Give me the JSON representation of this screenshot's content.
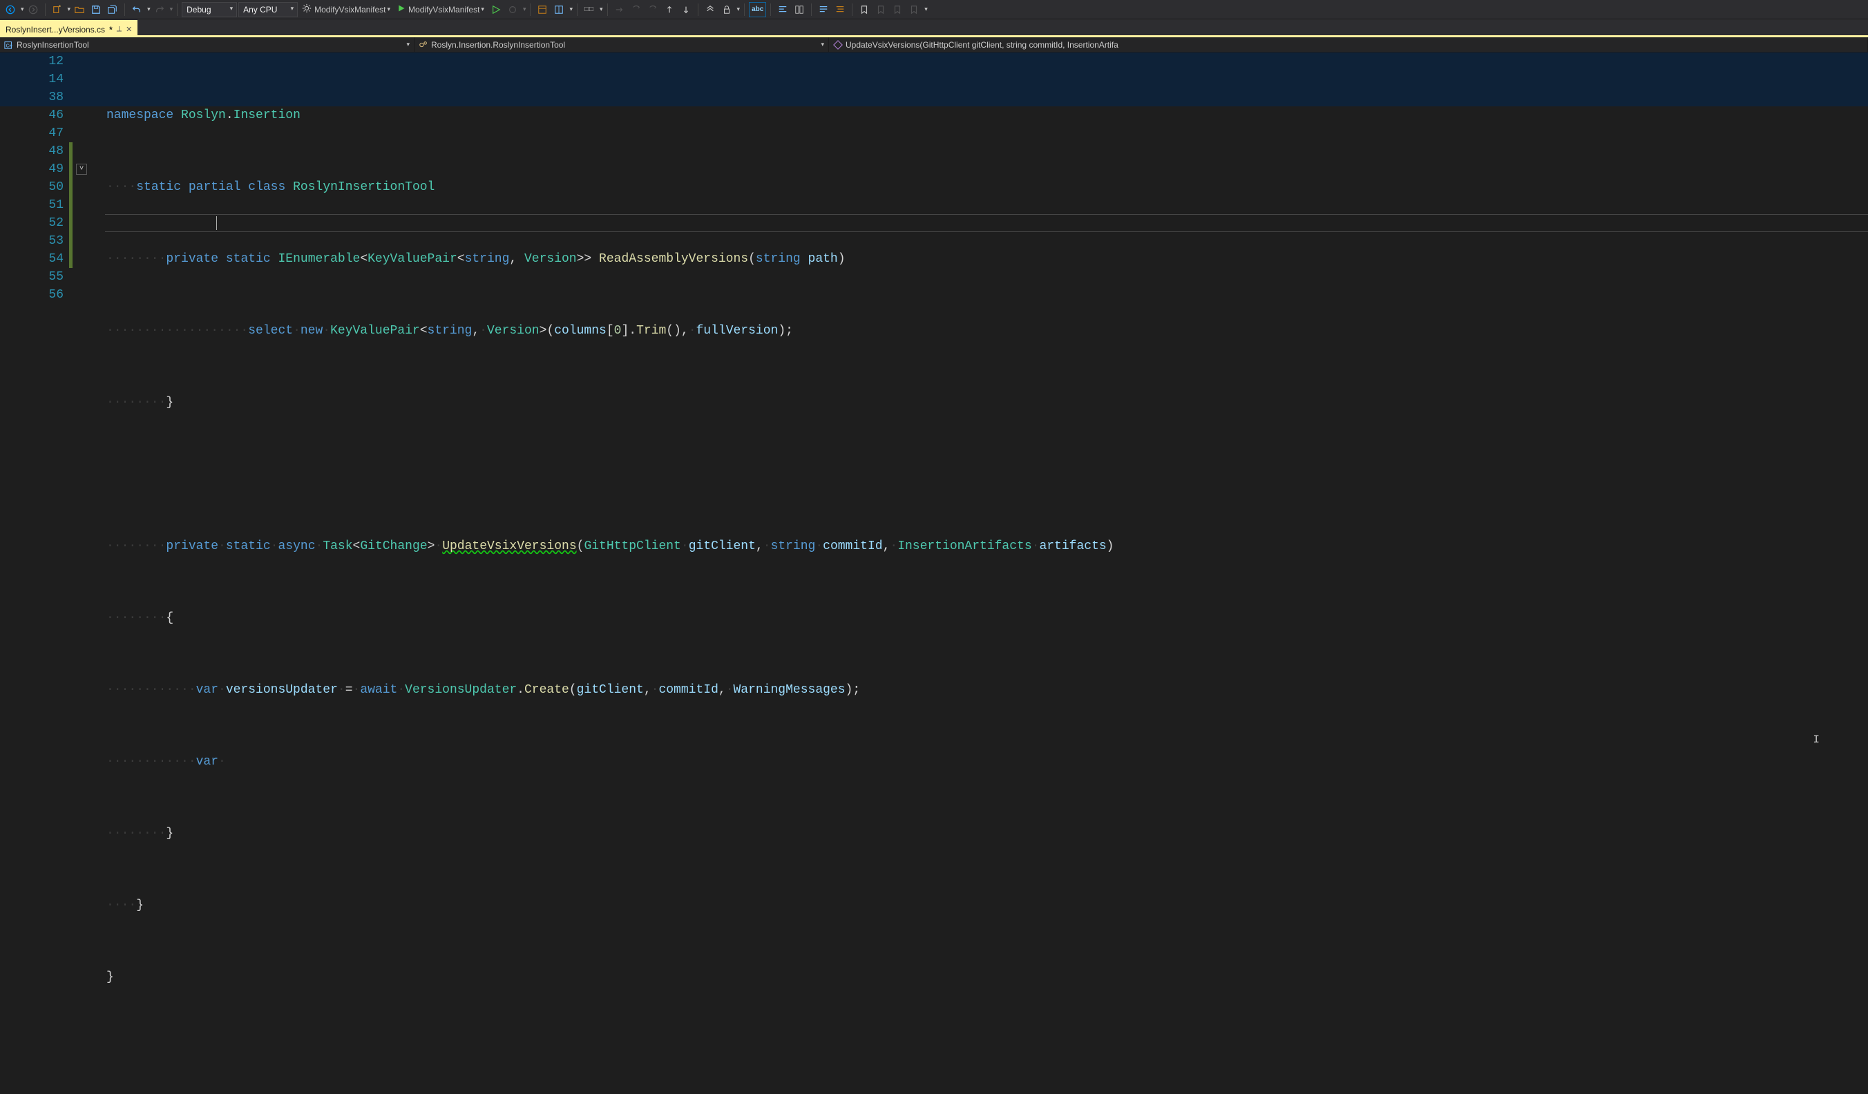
{
  "toolbar": {
    "config_combo": "Debug",
    "platform_combo": "Any CPU",
    "start1": "ModifyVsixManifest",
    "start2": "ModifyVsixManifest"
  },
  "tab": {
    "title": "RoslynInsert...yVersions.cs",
    "dirty": "*",
    "pin_glyph": "⟂",
    "close_glyph": "✕"
  },
  "nav": {
    "project": "RoslynInsertionTool",
    "type": "Roslyn.Insertion.RoslynInsertionTool",
    "member": "UpdateVsixVersions(GitHttpClient gitClient, string commitId, InsertionArtifa"
  },
  "line_numbers": [
    "12",
    "14",
    "38",
    "46",
    "47",
    "48",
    "49",
    "50",
    "51",
    "52",
    "53",
    "54",
    "55",
    "56"
  ],
  "code": {
    "l12": {
      "indent": "",
      "t1": "namespace",
      "t2": " ",
      "t3": "Roslyn",
      "t4": ".",
      "t5": "Insertion"
    },
    "l14": {
      "indent_ws": "····",
      "t1": "static",
      "t2": " ",
      "t3": "partial",
      "t4": " ",
      "t5": "class",
      "t6": " ",
      "t7": "RoslynInsertionTool"
    },
    "l38": {
      "indent_ws": "········",
      "t1": "private",
      "t2": " ",
      "t3": "static",
      "t4": " ",
      "t5": "IEnumerable",
      "t6": "<",
      "t7": "KeyValuePair",
      "t8": "<",
      "t9": "string",
      "t10": ",",
      "t11": " ",
      "t12": "Version",
      "t13": ">>",
      "t14": " ",
      "t15": "ReadAssemblyVersions",
      "t16": "(",
      "t17": "string",
      "t18": " ",
      "t19": "path",
      "t20": ")"
    },
    "l46": {
      "indent_ws": "···············",
      "t0": "····",
      "t1": "select",
      "t2": "·",
      "t3": "new",
      "t4": "·",
      "t5": "KeyValuePair",
      "t6": "<",
      "t7": "string",
      "t8": ",",
      "t9": "·",
      "t10": "Version",
      "t11": ">(",
      "t12": "columns",
      "t13": "[",
      "t14": "0",
      "t15": "].",
      "t16": "Trim",
      "t17": "(),",
      "t18": "·",
      "t19": "fullVersion",
      "t20": ");"
    },
    "l47": {
      "indent_ws": "········",
      "t1": "}"
    },
    "l48": "",
    "l49": {
      "indent_ws": "········",
      "t1": "private",
      "t2": "·",
      "t3": "static",
      "t4": "·",
      "t5": "async",
      "t6": "·",
      "t7": "Task",
      "t8": "<",
      "t9": "GitChange",
      "t10": ">",
      "t11": "·",
      "t12": "UpdateVsixVersions",
      "t13": "(",
      "t14": "GitHttpClient",
      "t15": "·",
      "t16": "gitClient",
      "t17": ",",
      "t18": "·",
      "t19": "string",
      "t20": "·",
      "t21": "commitId",
      "t22": ",",
      "t23": "·",
      "t24": "InsertionArtifacts",
      "t25": "·",
      "t26": "artifacts",
      "t27": ")"
    },
    "l50": {
      "indent_ws": "········",
      "t1": "{"
    },
    "l51": {
      "indent_ws": "············",
      "t1": "var",
      "t2": "·",
      "t3": "versionsUpdater",
      "t4": "·",
      "t5": "=",
      "t6": "·",
      "t7": "await",
      "t8": "·",
      "t9": "VersionsUpdater",
      "t10": ".",
      "t11": "Create",
      "t12": "(",
      "t13": "gitClient",
      "t14": ",",
      "t15": "·",
      "t16": "commitId",
      "t17": ",",
      "t18": "·",
      "t19": "WarningMessages",
      "t20": ");"
    },
    "l52": {
      "indent_ws": "············",
      "t1": "var",
      "t2": "·"
    },
    "l53": {
      "indent_ws": "········",
      "t1": "}"
    },
    "l54": {
      "indent_ws": "····",
      "t1": "}"
    },
    "l55": {
      "t1": "}"
    }
  }
}
